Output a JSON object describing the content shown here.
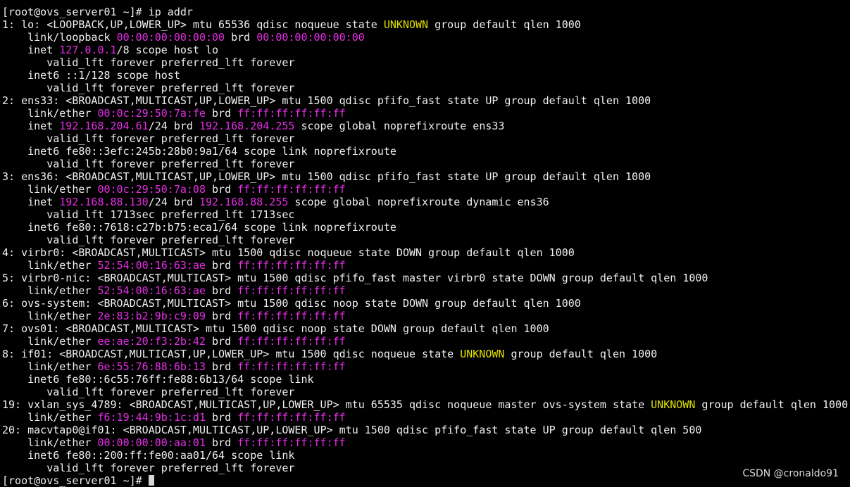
{
  "colors": {
    "background": "#000000",
    "text": "#f0f0f0",
    "address": "#e62ee6",
    "state_unknown": "#e0e000",
    "cursor": "#d6d6d6",
    "watermark": "#d8d8d8"
  },
  "terminal": {
    "lines": [
      [
        {
          "t": "[root@ovs_server01 ~]# ip addr",
          "c": "n"
        }
      ],
      [
        {
          "t": "1: lo: <LOOPBACK,UP,LOWER_UP> mtu 65536 qdisc noqueue state ",
          "c": "n"
        },
        {
          "t": "UNKNOWN",
          "c": "y"
        },
        {
          "t": " group default qlen 1000",
          "c": "n"
        }
      ],
      [
        {
          "t": "    link/loopback ",
          "c": "n"
        },
        {
          "t": "00:00:00:00:00:00",
          "c": "m"
        },
        {
          "t": " brd ",
          "c": "n"
        },
        {
          "t": "00:00:00:00:00:00",
          "c": "m"
        }
      ],
      [
        {
          "t": "    inet ",
          "c": "n"
        },
        {
          "t": "127.0.0.1",
          "c": "m"
        },
        {
          "t": "/8 scope host lo",
          "c": "n"
        }
      ],
      [
        {
          "t": "       valid_lft forever preferred_lft forever",
          "c": "n"
        }
      ],
      [
        {
          "t": "    inet6 ::1/128 scope host",
          "c": "n"
        }
      ],
      [
        {
          "t": "       valid_lft forever preferred_lft forever",
          "c": "n"
        }
      ],
      [
        {
          "t": "2: ens33: <BROADCAST,MULTICAST,UP,LOWER_UP> mtu 1500 qdisc pfifo_fast state UP group default qlen 1000",
          "c": "n"
        }
      ],
      [
        {
          "t": "    link/ether ",
          "c": "n"
        },
        {
          "t": "00:0c:29:50:7a:fe",
          "c": "m"
        },
        {
          "t": " brd ",
          "c": "n"
        },
        {
          "t": "ff:ff:ff:ff:ff:ff",
          "c": "m"
        }
      ],
      [
        {
          "t": "    inet ",
          "c": "n"
        },
        {
          "t": "192.168.204.61",
          "c": "m"
        },
        {
          "t": "/24 brd ",
          "c": "n"
        },
        {
          "t": "192.168.204.255",
          "c": "m"
        },
        {
          "t": " scope global noprefixroute ens33",
          "c": "n"
        }
      ],
      [
        {
          "t": "       valid_lft forever preferred_lft forever",
          "c": "n"
        }
      ],
      [
        {
          "t": "    inet6 fe80::3efc:245b:28b0:9a1/64 scope link noprefixroute",
          "c": "n"
        }
      ],
      [
        {
          "t": "       valid_lft forever preferred_lft forever",
          "c": "n"
        }
      ],
      [
        {
          "t": "3: ens36: <BROADCAST,MULTICAST,UP,LOWER_UP> mtu 1500 qdisc pfifo_fast state UP group default qlen 1000",
          "c": "n"
        }
      ],
      [
        {
          "t": "    link/ether ",
          "c": "n"
        },
        {
          "t": "00:0c:29:50:7a:08",
          "c": "m"
        },
        {
          "t": " brd ",
          "c": "n"
        },
        {
          "t": "ff:ff:ff:ff:ff:ff",
          "c": "m"
        }
      ],
      [
        {
          "t": "    inet ",
          "c": "n"
        },
        {
          "t": "192.168.88.130",
          "c": "m"
        },
        {
          "t": "/24 brd ",
          "c": "n"
        },
        {
          "t": "192.168.88.255",
          "c": "m"
        },
        {
          "t": " scope global noprefixroute dynamic ens36",
          "c": "n"
        }
      ],
      [
        {
          "t": "       valid_lft 1713sec preferred_lft 1713sec",
          "c": "n"
        }
      ],
      [
        {
          "t": "    inet6 fe80::7618:c27b:b75:eca1/64 scope link noprefixroute",
          "c": "n"
        }
      ],
      [
        {
          "t": "       valid_lft forever preferred_lft forever",
          "c": "n"
        }
      ],
      [
        {
          "t": "4: virbr0: <BROADCAST,MULTICAST> mtu 1500 qdisc noqueue state DOWN group default qlen 1000",
          "c": "n"
        }
      ],
      [
        {
          "t": "    link/ether ",
          "c": "n"
        },
        {
          "t": "52:54:00:16:63:ae",
          "c": "m"
        },
        {
          "t": " brd ",
          "c": "n"
        },
        {
          "t": "ff:ff:ff:ff:ff:ff",
          "c": "m"
        }
      ],
      [
        {
          "t": "5: virbr0-nic: <BROADCAST,MULTICAST> mtu 1500 qdisc pfifo_fast master virbr0 state DOWN group default qlen 1000",
          "c": "n"
        }
      ],
      [
        {
          "t": "    link/ether ",
          "c": "n"
        },
        {
          "t": "52:54:00:16:63:ae",
          "c": "m"
        },
        {
          "t": " brd ",
          "c": "n"
        },
        {
          "t": "ff:ff:ff:ff:ff:ff",
          "c": "m"
        }
      ],
      [
        {
          "t": "6: ovs-system: <BROADCAST,MULTICAST> mtu 1500 qdisc noop state DOWN group default qlen 1000",
          "c": "n"
        }
      ],
      [
        {
          "t": "    link/ether ",
          "c": "n"
        },
        {
          "t": "2e:83:b2:9b:c9:09",
          "c": "m"
        },
        {
          "t": " brd ",
          "c": "n"
        },
        {
          "t": "ff:ff:ff:ff:ff:ff",
          "c": "m"
        }
      ],
      [
        {
          "t": "7: ovs01: <BROADCAST,MULTICAST> mtu 1500 qdisc noop state DOWN group default qlen 1000",
          "c": "n"
        }
      ],
      [
        {
          "t": "    link/ether ",
          "c": "n"
        },
        {
          "t": "ee:ae:20:f3:2b:42",
          "c": "m"
        },
        {
          "t": " brd ",
          "c": "n"
        },
        {
          "t": "ff:ff:ff:ff:ff:ff",
          "c": "m"
        }
      ],
      [
        {
          "t": "8: if01: <BROADCAST,MULTICAST,UP,LOWER_UP> mtu 1500 qdisc noqueue state ",
          "c": "n"
        },
        {
          "t": "UNKNOWN",
          "c": "y"
        },
        {
          "t": " group default qlen 1000",
          "c": "n"
        }
      ],
      [
        {
          "t": "    link/ether ",
          "c": "n"
        },
        {
          "t": "6e:55:76:88:6b:13",
          "c": "m"
        },
        {
          "t": " brd ",
          "c": "n"
        },
        {
          "t": "ff:ff:ff:ff:ff:ff",
          "c": "m"
        }
      ],
      [
        {
          "t": "    inet6 fe80::6c55:76ff:fe88:6b13/64 scope link",
          "c": "n"
        }
      ],
      [
        {
          "t": "       valid_lft forever preferred_lft forever",
          "c": "n"
        }
      ],
      [
        {
          "t": "19: vxlan_sys_4789: <BROADCAST,MULTICAST,UP,LOWER_UP> mtu 65535 qdisc noqueue master ovs-system state ",
          "c": "n"
        },
        {
          "t": "UNKNOWN",
          "c": "y"
        },
        {
          "t": " group default qlen 1000",
          "c": "n"
        }
      ],
      [
        {
          "t": "    link/ether ",
          "c": "n"
        },
        {
          "t": "f6:19:44:9b:1c:d1",
          "c": "m"
        },
        {
          "t": " brd ",
          "c": "n"
        },
        {
          "t": "ff:ff:ff:ff:ff:ff",
          "c": "m"
        }
      ],
      [
        {
          "t": "20: macvtap0@if01: <BROADCAST,MULTICAST,UP,LOWER_UP> mtu 1500 qdisc pfifo_fast state UP group default qlen 500",
          "c": "n"
        }
      ],
      [
        {
          "t": "    link/ether ",
          "c": "n"
        },
        {
          "t": "00:00:00:00:aa:01",
          "c": "m"
        },
        {
          "t": " brd ",
          "c": "n"
        },
        {
          "t": "ff:ff:ff:ff:ff:ff",
          "c": "m"
        }
      ],
      [
        {
          "t": "    inet6 fe80::200:ff:fe00:aa01/64 scope link",
          "c": "n"
        }
      ],
      [
        {
          "t": "       valid_lft forever preferred_lft forever",
          "c": "n"
        }
      ],
      [
        {
          "t": "[root@ovs_server01 ~]# ",
          "c": "n"
        }
      ]
    ]
  },
  "watermark": "CSDN @cronaldo91"
}
